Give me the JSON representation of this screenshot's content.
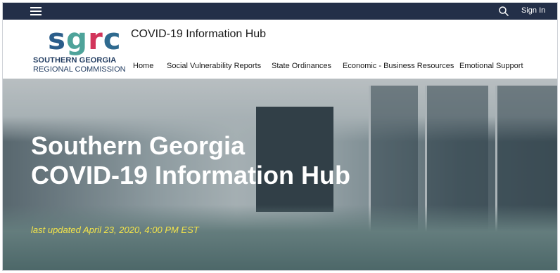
{
  "topbar": {
    "menu_icon": "hamburger-menu-icon",
    "search_icon": "search-icon",
    "sign_in_label": "Sign In",
    "background_color": "#232f48"
  },
  "logo": {
    "mark": {
      "s": "s",
      "g": "g",
      "r": "r",
      "c": "c"
    },
    "line1": "SOUTHERN GEORGIA",
    "line2": "REGIONAL COMMISSION",
    "colors": {
      "s": "#2b5d8a",
      "g": "#4ea39a",
      "r": "#d2355b",
      "c": "#2f6a8f"
    }
  },
  "header": {
    "site_title": "COVID-19 Information Hub"
  },
  "nav": {
    "items": [
      {
        "label": "Home"
      },
      {
        "label": "Social Vulnerability Reports"
      },
      {
        "label": "State Ordinances"
      },
      {
        "label": "Economic - Business Resources"
      },
      {
        "label": "Emotional Support"
      }
    ]
  },
  "hero": {
    "title_line1": "Southern Georgia",
    "title_line2": "COVID-19 Information Hub",
    "updated": "last updated April 23, 2020, 4:00 PM EST",
    "updated_color": "#f3e34a"
  }
}
